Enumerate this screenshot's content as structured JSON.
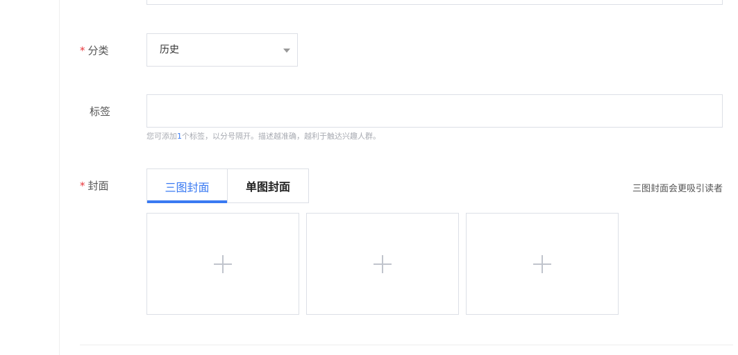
{
  "category": {
    "required_mark": "*",
    "label": "分类",
    "selected": "历史"
  },
  "tags": {
    "label": "标签",
    "value": "",
    "hint_prefix": "您可添加",
    "hint_num": "1",
    "hint_suffix": "个标签，以分号隔开。描述越准确，越利于触达兴趣人群。"
  },
  "cover": {
    "required_mark": "*",
    "label": "封面",
    "tabs": [
      {
        "label": "三图封面",
        "active": true
      },
      {
        "label": "单图封面",
        "active": false
      }
    ],
    "tip": "三图封面会更吸引读者",
    "slots": [
      {
        "icon": "plus-icon"
      },
      {
        "icon": "plus-icon"
      },
      {
        "icon": "plus-icon"
      }
    ]
  },
  "colors": {
    "accent": "#3a7af2",
    "required": "#e8383d",
    "border": "#dcdfe6"
  }
}
